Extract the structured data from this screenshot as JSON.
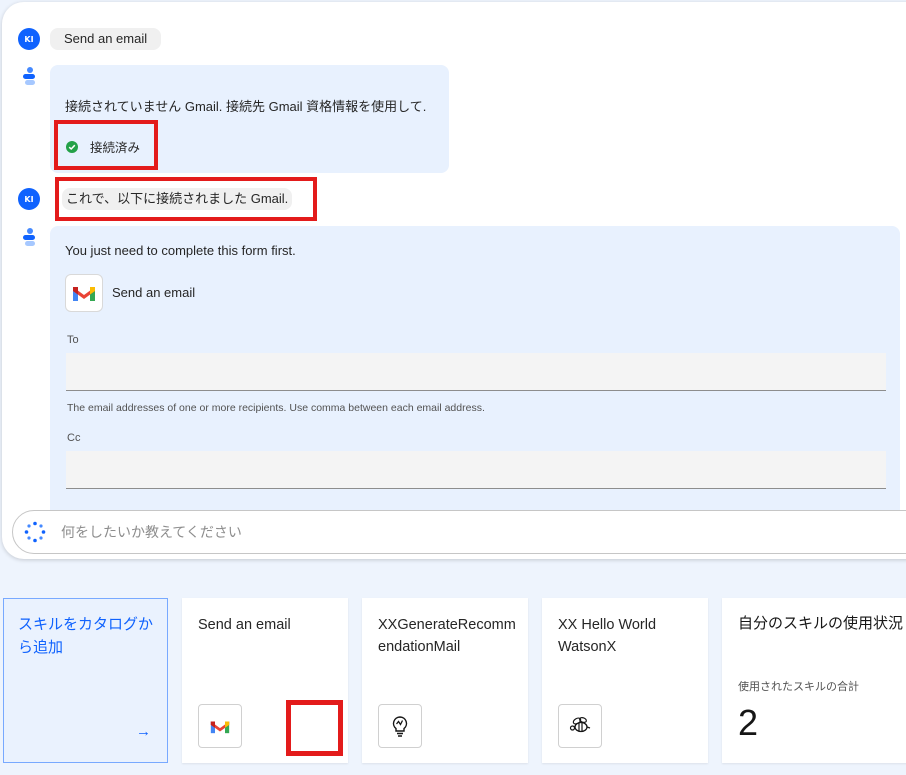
{
  "conversation": {
    "user_messages": [
      {
        "avatar": "KI",
        "text": "Send an email"
      },
      {
        "avatar": "KI",
        "text": "これで、以下に接続されました Gmail."
      }
    ],
    "bot_message_1": {
      "text": "接続されていません Gmail. 接続先 Gmail 資格情報を使用して.",
      "status_label": "接続済み"
    },
    "bot_message_2": {
      "intro": "You just need to complete this form first.",
      "skill_name": "Send an email",
      "to_label": "To",
      "to_value": "",
      "to_hint": "The email addresses of one or more recipients. Use comma between each email address.",
      "cc_label": "Cc",
      "cc_value": ""
    }
  },
  "chat_input": {
    "placeholder": "何をしたいか教えてください"
  },
  "skills": {
    "add_card": {
      "label": "スキルをカタログから追加",
      "arrow": "→"
    },
    "cards": [
      {
        "title": "Send an email",
        "icon": "gmail-icon"
      },
      {
        "title": "XXGenerateRecommendationMail",
        "icon": "lightbulb-icon"
      },
      {
        "title": "XX Hello World WatsonX",
        "icon": "bee-icon"
      }
    ],
    "usage": {
      "title": "自分のスキルの使用状況",
      "total_label": "使用されたスキルの合計",
      "total_value": "2"
    }
  },
  "colors": {
    "accent": "#0f62fe",
    "bubble": "#e8f1fe",
    "highlight": "#e31b1b",
    "success": "#24a148"
  }
}
